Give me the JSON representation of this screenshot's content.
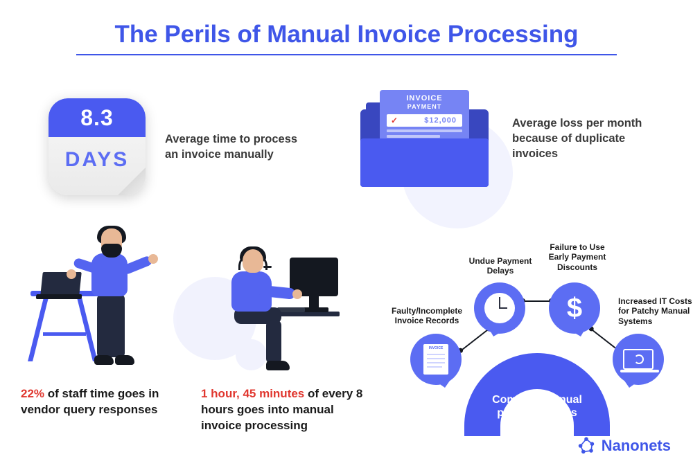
{
  "title": "The Perils of Manual Invoice Processing",
  "calendar": {
    "value": "8.3",
    "unit": "DAYS"
  },
  "stat_avg_time": "Average time to process an invoice manually",
  "invoice_icon": {
    "heading": "INVOICE",
    "sub": "PAYMENT",
    "amount": "$12,000"
  },
  "stat_avg_loss": "Average loss per month because of duplicate invoices",
  "staff_time": {
    "highlight": "22%",
    "rest": " of staff time goes in vendor query responses"
  },
  "manual_time": {
    "highlight": "1 hour, 45 minutes",
    "rest": " of every 8 hours goes into manual invoice processing"
  },
  "diagram": {
    "center": "Common manual process issues",
    "items": [
      "Faulty/Incomplete Invoice Records",
      "Undue Payment Delays",
      "Failure to Use Early Payment Discounts",
      "Increased IT Costs for Patchy Manual Systems"
    ]
  },
  "brand": "Nanonets",
  "colors": {
    "primary": "#4a5af0",
    "accent_red": "#e0362e"
  }
}
